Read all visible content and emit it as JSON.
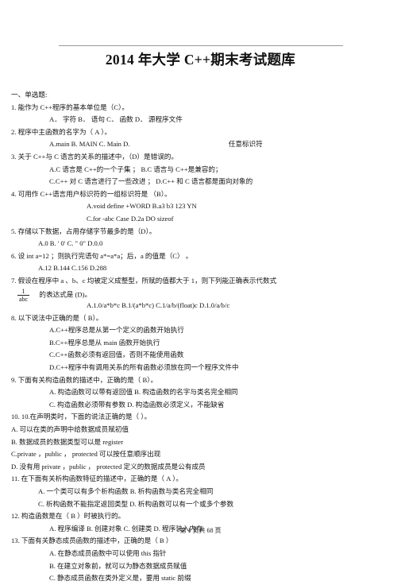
{
  "document": {
    "title": "2014 年大学 C++期末考试题库",
    "footer": "第 1 页共 68 页",
    "section_heading": "一、单选题:"
  },
  "questions": [
    {
      "number": "1.",
      "stem": "能作为 C++程序的基本单位是（C）。",
      "options_line": "A．  字符   B．  语句   C．  函数   D．   源程序文件"
    },
    {
      "number": "2.",
      "stem": "程序中主函数的名字为（  A ）。",
      "options_line": "A.main    B. MAIN    C. Main    D.",
      "options_tail": "任意标识符"
    },
    {
      "number": "3.",
      "stem": "关于 C++与 C 语言的关系的描述中，（D）是错误的。",
      "opt_line_1": "A.C     语言是 C++的一个子集 ；   B.C    语言与 C++是兼容的；",
      "opt_line_2": "C.C++     对 C 语言进行了一些改进 ；   D.C++ 和 C 语言都是面向对象的"
    },
    {
      "number": "4.",
      "stem": "可用作 C++语言用户标识符的一组标识符是 （B）。",
      "opt_line_1": "A.void   define   +WORD     B.a3 b3    123   YN",
      "opt_line_2": "C.for   -abc   Case     D.2a    DO   sizeof"
    },
    {
      "number": "5.",
      "stem": "存储以下数据，占用存储字节最多的是（D）。",
      "opt_line_1": "A.0   B.          ' 0'    C. \" 0\" D.0.0"
    },
    {
      "number": "6.",
      "stem": "设 int a=12  ；则执行完语句  a*=a*a；后，a 的值是（C） 。",
      "opt_line_1": "A.12    B.144  C.156     D.288"
    },
    {
      "number": "7.",
      "stem_line_1": "假设在程序中  a 、b、c 均被定义成整型，所赋的值都大于    1，则下列能正确表示代数式",
      "frac_num": "1",
      "frac_den": "abc",
      "stem_line_2": "的表达式是 (D)。",
      "opt_line_1": "A.1.0/a*b*c   B.1/(a*b*c)   C.1/a/b/(float)c   D.1.0/a/b/c"
    },
    {
      "number": "8.",
      "stem": "以下说法中正确的是（  B）。",
      "opts": [
        "A.C++程序总是从第一个定义的函数开始执行",
        "B.C++程序总是从  main 函数开始执行",
        "C.C++函数必须有返回值，否则不能使用函数",
        "D.C++程序中有调用关系的所有函数必须放在同一个程序文件中"
      ]
    },
    {
      "number": "9.",
      "stem": "下面有关构造函数的描述中，正确的是（   B）。",
      "opt_line_1": "A.      构造函数可以带有返回值       B.      构造函数的名字与类名完全相同",
      "opt_line_2": "C.      构造函数必须带有参数       D.      构造函数必须定义，不能缺省"
    },
    {
      "number": "10.",
      "stem": "10.在声明类时，下面的说法正确的是（        ）。",
      "opts": [
        "A. 可以在类的声明中给数据成员赋初值",
        "B. 数据成员的数据类型可以是 register",
        "C.private ，public ， protected 可以按任意顺序出现",
        "D. 没有用 private ，public ， protected 定义的数据成员是公有成员"
      ]
    },
    {
      "number": "11.",
      "stem": "在下面有关析构函数特征的描述中，正确的是（     A ）。",
      "opt_line_1": "A.      一个类可以有多个析构函数    B.      析构函数与类名完全相同",
      "opt_line_2": "C.      析构函数不能指定返回类型    D.      析构函数可以有一个或多个参数"
    },
    {
      "number": "12.",
      "stem": "构造函数是在（  B ）时被执行的。",
      "opt_line_1": "A.      程序编译    B.      创建对象   C.      创建类    D.      程序装入内存"
    },
    {
      "number": "13.",
      "stem": "下面有关静态成员函数的描述中，正确的是（     B   ）",
      "opts": [
        "A.      在静态成员函数中可以使用 this  指针",
        "B.      在建立对象前，就可以为静态数据成员赋值",
        "C.      静态成员函数在类外定义是，要用 static   前缀"
      ]
    }
  ]
}
